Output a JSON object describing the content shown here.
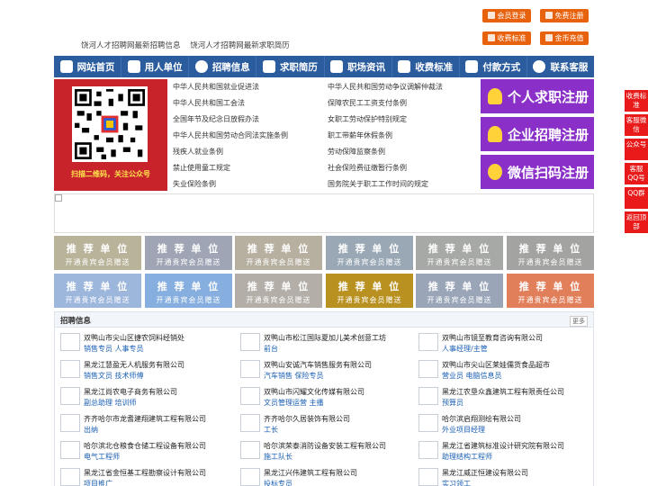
{
  "top": {
    "links": [
      "饶河人才招聘网最新招聘信息",
      "饶河人才招聘网最新求职简历"
    ],
    "buttons": [
      {
        "label": "会员登录",
        "icon": "user-icon"
      },
      {
        "label": "免费注册",
        "icon": "register-icon"
      },
      {
        "label": "收费标准",
        "icon": "price-icon"
      },
      {
        "label": "金币充值",
        "icon": "coin-icon"
      }
    ]
  },
  "nav": [
    {
      "label": "网站首页",
      "icon": "home-icon"
    },
    {
      "label": "用人单位",
      "icon": "building-icon"
    },
    {
      "label": "招聘信息",
      "icon": "recruit-icon"
    },
    {
      "label": "求职简历",
      "icon": "resume-icon"
    },
    {
      "label": "职场资讯",
      "icon": "news-icon"
    },
    {
      "label": "收费标准",
      "icon": "fee-icon"
    },
    {
      "label": "付款方式",
      "icon": "payment-icon"
    },
    {
      "label": "联系客服",
      "icon": "service-icon"
    }
  ],
  "qr": {
    "caption": "扫描二维码，关注公众号"
  },
  "laws": {
    "left": [
      "中华人民共和国就业促进法",
      "中华人民共和国工会法",
      "全国年节及纪念日放假办法",
      "中华人民共和国劳动合同法实施条例",
      "残疾人就业条例",
      "禁止使用童工规定",
      "失业保险条例"
    ],
    "right": [
      "中华人民共和国劳动争议调解仲裁法",
      "保障农民工工资支付条例",
      "女职工劳动保护特别规定",
      "职工带薪年休假条例",
      "劳动保障监察条例",
      "社会保险费征缴暂行条例",
      "国务院关于职工工作时间的规定"
    ]
  },
  "register": [
    "个人求职注册",
    "企业招聘注册",
    "微信扫码注册"
  ],
  "promo": {
    "title": "推 荐 单 位",
    "subtitle": "开通贵宾会员赠送",
    "colors": [
      "#b9b39a",
      "#9fa5b4",
      "#b7b0a1",
      "#9aa8b5",
      "#a7a9a6",
      "#a3a3a1",
      "#9db6dc",
      "#86aede",
      "#b3aea8",
      "#b89121",
      "#9aa5b8",
      "#e27f5b"
    ]
  },
  "jobs": {
    "title": "招聘信息",
    "more": "更多",
    "items": [
      {
        "company": "双鸭山市尖山区捷农饲料经销处",
        "positions": "销售专员 人事专员"
      },
      {
        "company": "双鸭山市松江国际夏加儿美术创意工坊",
        "positions": "前台"
      },
      {
        "company": "双鸭山市镜至教育咨询有限公司",
        "positions": "人事经理/主管"
      },
      {
        "company": "黑龙江慧盈无人机服务有限公司",
        "positions": "销售文员 技术师傅"
      },
      {
        "company": "双鸭山安诚汽车销售服务有限公司",
        "positions": "汽车销售 保险专员"
      },
      {
        "company": "双鸭山市尖山区莱娃儒货食品超市",
        "positions": "营业员 电脑信息员"
      },
      {
        "company": "黑龙江尚农电子商务有限公司",
        "positions": "副总助理 培训师"
      },
      {
        "company": "双鸭山市闪耀文化传媒有限公司",
        "positions": "文员管理运营 主播"
      },
      {
        "company": "黑龙江农垦众鑫建筑工程有限责任公司",
        "positions": "预算员"
      },
      {
        "company": "齐齐哈尔市龙耆建翔建筑工程有限公司",
        "positions": "出纳"
      },
      {
        "company": "齐齐哈尔久居装饰有限公司",
        "positions": "工长"
      },
      {
        "company": "哈尔滨启翔测绘有限公司",
        "positions": "外业项目经理"
      },
      {
        "company": "哈尔滨北仓粮食仓储工程设备有限公司",
        "positions": "电气工程师"
      },
      {
        "company": "哈尔滨荣泰消防设备安装工程有限公司",
        "positions": "施工队长"
      },
      {
        "company": "黑龙江省建筑标准设计研究院有限公司",
        "positions": "助理结构工程师"
      },
      {
        "company": "黑龙江省金恒基工程勘察设计有限公司",
        "positions": "项目推广"
      },
      {
        "company": "黑龙江兴伟建筑工程有限公司",
        "positions": "投标专员"
      },
      {
        "company": "黑龙江威正恒建设有限公司",
        "positions": "实习领工"
      }
    ]
  },
  "float": [
    "收费标准",
    "客服微信",
    "公众号",
    "客服QQ号",
    "QQ群",
    "返回顶部"
  ]
}
